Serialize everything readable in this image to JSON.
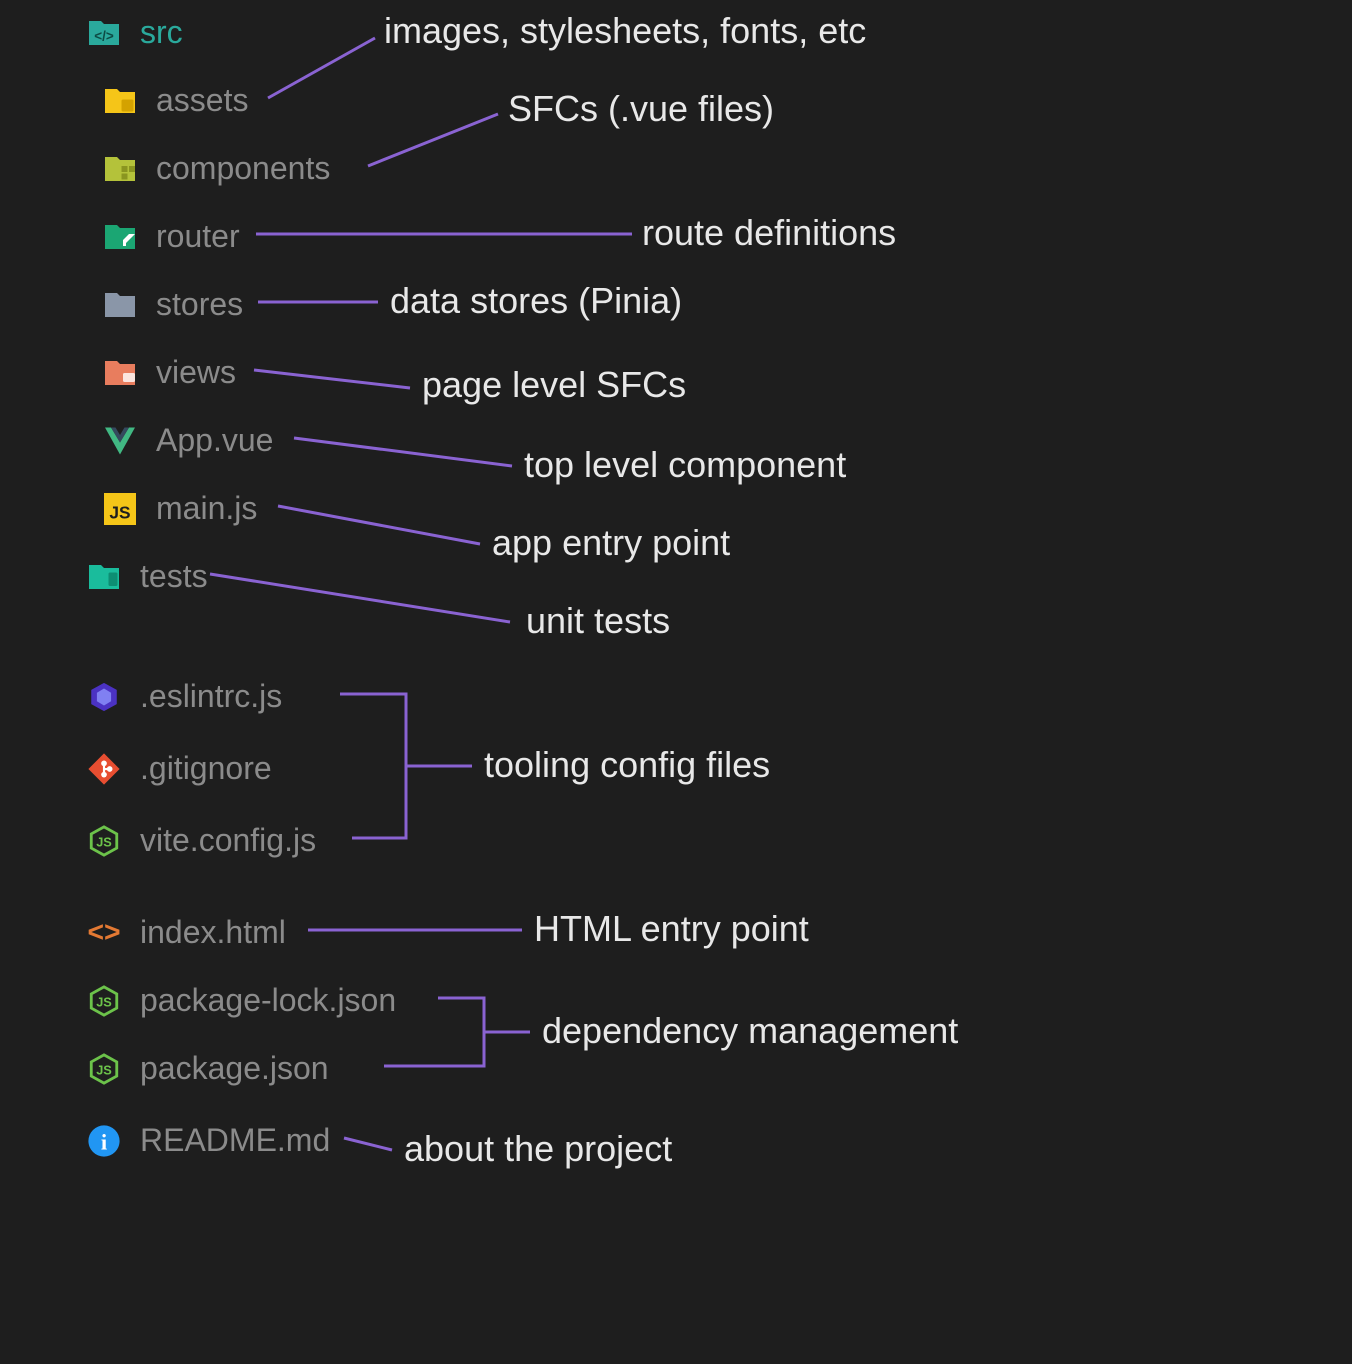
{
  "tree": {
    "src": {
      "label": "src"
    },
    "assets": {
      "label": "assets"
    },
    "components": {
      "label": "components"
    },
    "router": {
      "label": "router"
    },
    "stores": {
      "label": "stores"
    },
    "views": {
      "label": "views"
    },
    "app_vue": {
      "label": "App.vue"
    },
    "main_js": {
      "label": "main.js"
    },
    "tests": {
      "label": "tests"
    },
    "eslintrc": {
      "label": ".eslintrc.js"
    },
    "gitignore": {
      "label": ".gitignore"
    },
    "vite_config": {
      "label": "vite.config.js"
    },
    "index_html": {
      "label": "index.html"
    },
    "package_lock": {
      "label": "package-lock.json"
    },
    "package_json": {
      "label": "package.json"
    },
    "readme": {
      "label": "README.md"
    }
  },
  "annotations": {
    "assets": "images, stylesheets, fonts, etc",
    "components": "SFCs (.vue files)",
    "router": "route definitions",
    "stores": "data stores (Pinia)",
    "views": "page level SFCs",
    "app_vue": "top level component",
    "main_js": "app entry point",
    "tests": "unit tests",
    "tooling": "tooling config files",
    "index_html": "HTML entry point",
    "deps": "dependency management",
    "readme": "about the project"
  },
  "colors": {
    "connector": "#8a63d2",
    "bg": "#1e1e1e",
    "text_muted": "#8b8b8b",
    "text_light": "#e8e8e8",
    "accent_teal": "#2aa99c"
  }
}
